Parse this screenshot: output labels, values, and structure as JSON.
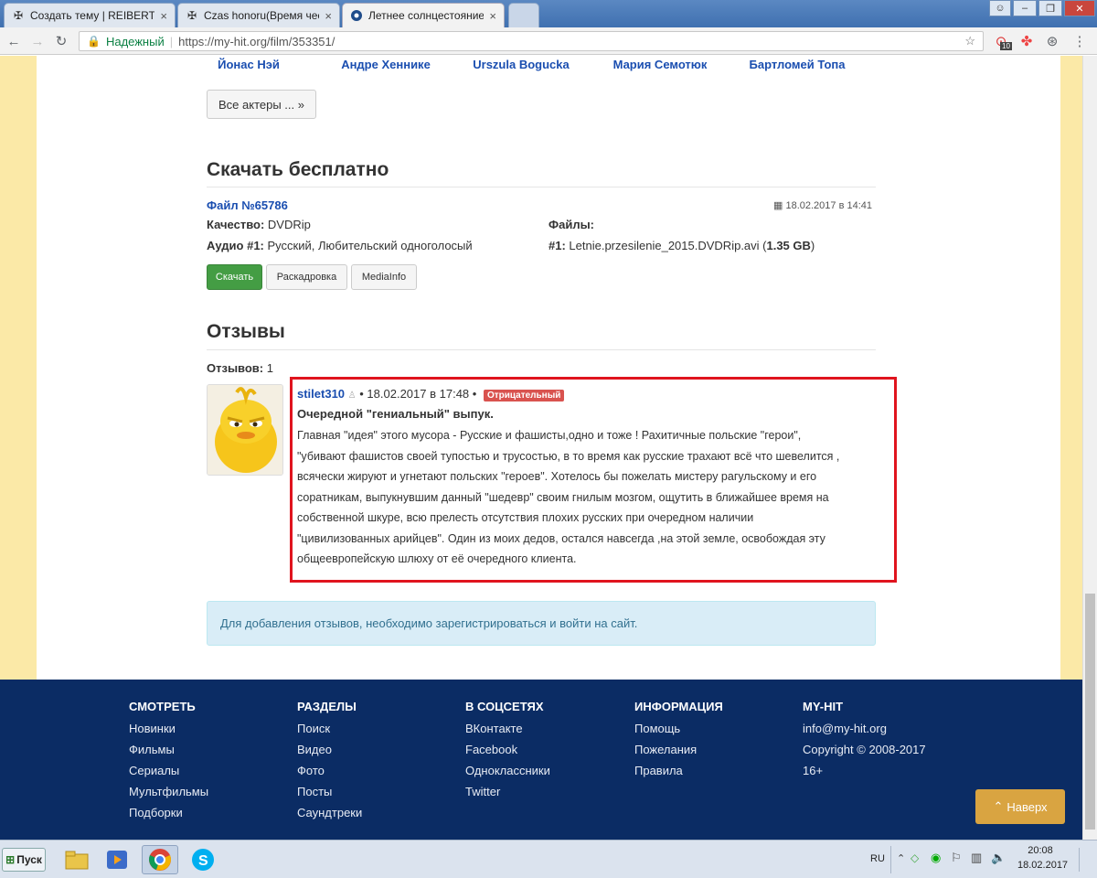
{
  "browser": {
    "tabs": [
      {
        "label": "Создать тему | REIBERT.i",
        "icon": "reibert-cross-icon",
        "active": false
      },
      {
        "label": "Czas honoru(Время чест",
        "icon": "reibert-cross-icon",
        "active": false
      },
      {
        "label": "Летнее солнцестояние (",
        "icon": "my-hit-icon",
        "active": true
      }
    ],
    "secure_label": "Надежный",
    "url": "https://my-hit.org/film/353351/",
    "extension_badge": "10"
  },
  "actors": {
    "names": [
      "Йонас Нэй",
      "Андре Хенникe",
      "Urszula Bogucka",
      "Мария Семотюк",
      "Бартломей Топа"
    ],
    "all_button": "Все актеры ... »"
  },
  "download": {
    "title": "Скачать бесплатно",
    "file_link": "Файл №65786",
    "date": "18.02.2017 в 14:41",
    "quality_label": "Качество:",
    "quality_value": "DVDRip",
    "audio_label": "Аудио #1:",
    "audio_value": "Русский, Любительский одноголосый",
    "files_label": "Файлы:",
    "file_num_label": "#1:",
    "file_name": "Letnie.przesilenie_2015.DVDRip.avi (",
    "file_size": "1.35 GB",
    "file_close": ")",
    "buttons": {
      "download": "Скачать",
      "storyboard": "Раскадровка",
      "mediainfo": "MediaInfo"
    }
  },
  "reviews": {
    "title": "Отзывы",
    "count_label": "Отзывов:",
    "count_value": "1",
    "items": [
      {
        "author": "stilet310",
        "date": "• 18.02.2017 в 17:48 •",
        "badge": "Отрицательный",
        "headline": "Очередной \"гениальный\" выпук.",
        "lines": [
          "Главная \"идея\" этого мусора - Русские и фашисты,одно и тоже ! Рахитичные польские \"герои\",",
          "\"убивают фашистов своей тупостью и трусостью, в то время как русские трахают всё что шевелится ,",
          "всячески жируют и угнетают польских \"героев\". Хотелось бы пожелать мистеру рагульскому и его",
          "соратникам, выпукнувшим данный \"шедевр\" своим гнилым мозгом, ощутить в ближайшее время на",
          "собственной шкуре, всю прелесть отсутствия плохих русских при очередном наличии",
          "\"цивилизованных арийцев\". Один из моих дедов, остался навсегда ,на этой земле, освобождая эту",
          "общеевропейскую шлюху от её очередного клиента."
        ]
      }
    ],
    "login_notice": "Для добавления отзывов, необходимо зарегистрироваться и войти на сайт."
  },
  "footer": {
    "columns": [
      {
        "heading": "СМОТРЕТЬ",
        "items": [
          "Новинки",
          "Фильмы",
          "Сериалы",
          "Мультфильмы",
          "Подборки"
        ]
      },
      {
        "heading": "РАЗДЕЛЫ",
        "items": [
          "Поиск",
          "Видео",
          "Фото",
          "Посты",
          "Саундтреки"
        ]
      },
      {
        "heading": "В СОЦСЕТЯХ",
        "items": [
          "ВКонтакте",
          "Facebook",
          "Одноклассники",
          "Twitter"
        ]
      },
      {
        "heading": "ИНФОРМАЦИЯ",
        "items": [
          "Помощь",
          "Пожелания",
          "Правила"
        ]
      },
      {
        "heading": "MY-HIT",
        "items": [
          "info@my-hit.org",
          "Copyright © 2008-2017",
          "16+"
        ]
      }
    ],
    "back_to_top": "Наверх"
  },
  "taskbar": {
    "start_label": "Пуск",
    "language": "RU",
    "time": "20:08",
    "date": "18.02.2017"
  },
  "colors": {
    "page_bg": "#fbe9a7",
    "footer_bg": "#0b2c64",
    "link": "#1a4eb0",
    "success_button": "#449d44",
    "badge_negative": "#d9534f",
    "highlight_border": "#e0141e",
    "back_to_top": "#d9a441"
  }
}
